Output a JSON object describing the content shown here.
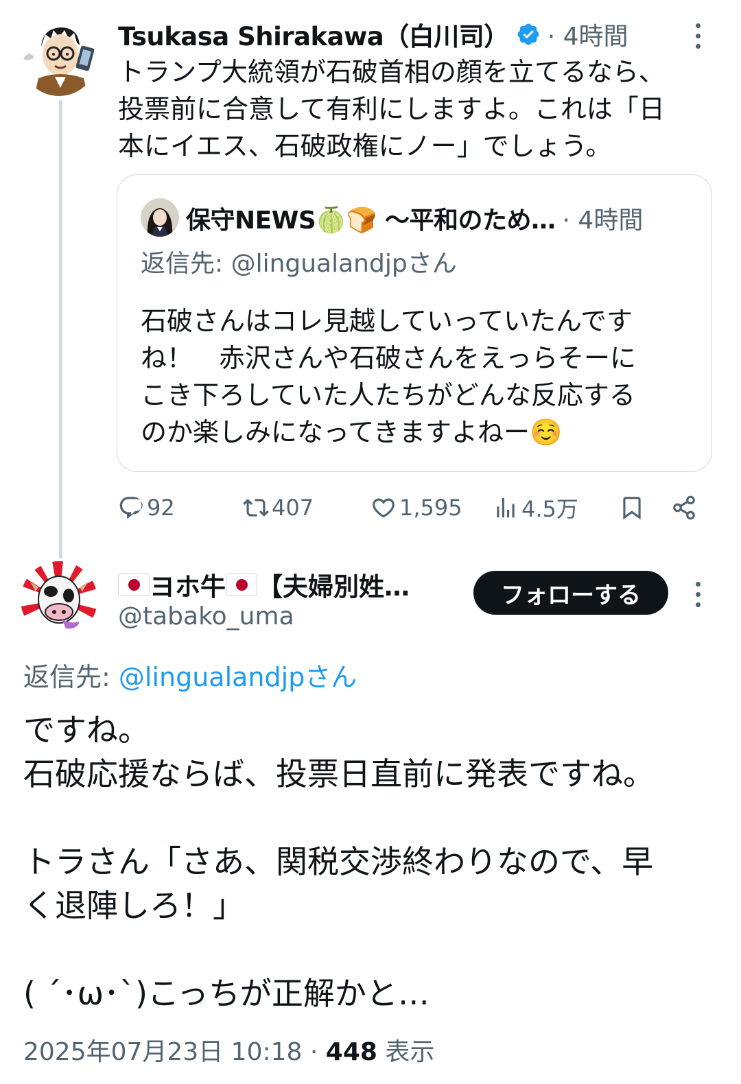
{
  "tweet1": {
    "author_name": "Tsukasa Shirakawa（白川司）",
    "time": "· 4時間",
    "text": "トランプ大統領が石破首相の顔を立てるなら、\n投票前に合意して有利にしますよ。これは「日\n本にイエス、石破政権にノー」でしょう。",
    "quote": {
      "author_name": "保守NEWS🍈🍞 〜平和のため…",
      "time": "· 4時間",
      "reply_to": "返信先: @lingualandjpさん",
      "text": "石破さんはコレ見越していっていたんです\nね！　赤沢さんや石破さんをえっらそーに\nこき下ろしていた人たちがどんな反応する\nのか楽しみになってきますよねー☺️"
    },
    "stats": {
      "replies": "92",
      "retweets": "407",
      "likes": "1,595",
      "views": "4.5万"
    }
  },
  "tweet2": {
    "author_name": "ヨホ牛",
    "author_name_suffix": "【夫婦別姓…",
    "handle": "@tabako_uma",
    "follow_label": "フォローする",
    "reply_label": "返信先: ",
    "reply_mention": "@lingualandjpさん",
    "text": "ですね。\n石破応援ならば、投票日直前に発表ですね。\n\nトラさん「さあ、関税交渉終わりなので、早\nく退陣しろ！」\n\n( ´･ω･`)こっちが正解かと…",
    "timestamp": "2025年07月23日 10:18 · ",
    "view_count": "448",
    "view_label": " 表示"
  },
  "icons": [
    "verified-badge-icon",
    "more-icon",
    "reply-icon",
    "retweet-icon",
    "like-icon",
    "views-icon",
    "bookmark-icon",
    "share-icon",
    "japan-flag-icon"
  ],
  "colors": {
    "text": "#0f1419",
    "secondary": "#536471",
    "accent": "#1d9bf0",
    "border": "#cfd9de",
    "follow_button": "#0f1419"
  }
}
